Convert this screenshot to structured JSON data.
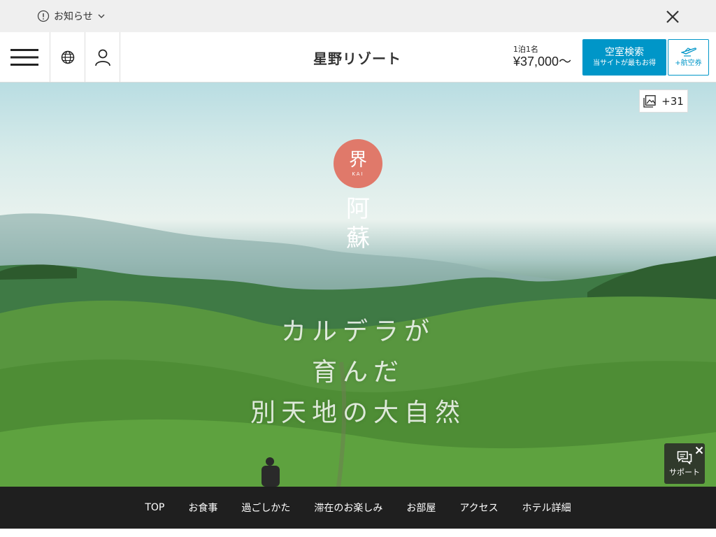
{
  "notice_bar": {
    "label": "お知らせ"
  },
  "header": {
    "brand": "星野リゾート",
    "price_unit": "1泊1名",
    "price_value": "¥37,000〜",
    "search_button": {
      "label": "空室検索",
      "sublabel": "当サイトが最もお得"
    },
    "flight_button": {
      "label": "+航空券"
    }
  },
  "hero": {
    "gallery_count": "+31",
    "brand_mark": {
      "kanji": "界",
      "roman": "KAI"
    },
    "place_name": [
      "阿",
      "蘇"
    ],
    "tagline": [
      "カルデラが",
      "育んだ",
      "別天地の大自然"
    ],
    "support_label": "サポート"
  },
  "bottom_nav": {
    "items": [
      "TOP",
      "お食事",
      "過ごしかた",
      "滞在のお楽しみ",
      "お部屋",
      "アクセス",
      "ホテル詳細"
    ]
  },
  "colors": {
    "accent": "#0096c8",
    "brand_circle": "#e0796a",
    "nav_background": "#1f1f1f"
  },
  "icons": {
    "notice": "info-circle-icon",
    "close": "close-icon",
    "menu": "hamburger-menu-icon",
    "language": "globe-icon",
    "account": "user-icon",
    "flight": "airplane-icon",
    "gallery": "image-gallery-icon",
    "support": "chat-bubble-icon"
  }
}
